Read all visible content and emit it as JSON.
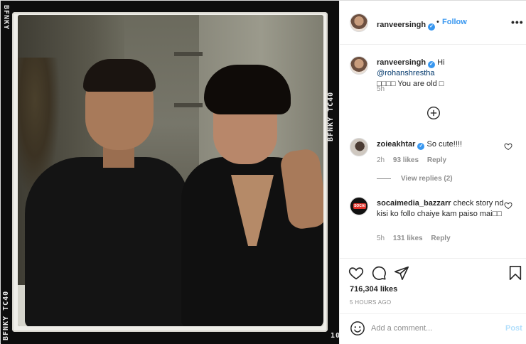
{
  "photo": {
    "film_text_top_left": "BFNKY",
    "film_text_top_right": "BFNKY TC40",
    "film_text_bottom_left": "BFNKY TC40",
    "film_text_bottom_right": "10"
  },
  "header": {
    "username": "ranveersingh",
    "verified_mark": "✓",
    "separator": "•",
    "follow_label": "Follow",
    "more_icon": "more-horizontal-icon",
    "more_glyph": "•••"
  },
  "caption": {
    "username": "ranveersingh",
    "text_prefix": "Hi ",
    "mention": "@rohanshrestha",
    "text_suffix": "□□□□ You are old □",
    "time": "5h"
  },
  "load_more": {
    "icon": "plus-circle-icon"
  },
  "comments": [
    {
      "username": "zoieakhtar",
      "verified": true,
      "text": "So cute!!!!",
      "time": "2h",
      "likes": "93 likes",
      "reply_label": "Reply",
      "view_replies": "View replies (2)"
    },
    {
      "username": "socaimedia_bazzarr",
      "verified": false,
      "text": "check story nd kisi ko follo chaiye kam paiso mai□□",
      "time": "5h",
      "likes": "131 likes",
      "reply_label": "Reply",
      "avatar_badge": "SOCAI"
    }
  ],
  "actions": {
    "like_icon": "heart-icon",
    "comment_icon": "comment-icon",
    "share_icon": "send-icon",
    "save_icon": "bookmark-icon",
    "likes_count": "716,304 likes",
    "posted_ago": "5 HOURS AGO"
  },
  "add_comment": {
    "placeholder": "Add a comment...",
    "post_label": "Post",
    "emoji_icon": "smiley-icon"
  },
  "colors": {
    "accent": "#3897f0",
    "muted": "#8e8e8e",
    "text": "#262626",
    "post_disabled": "#b2dffc"
  }
}
